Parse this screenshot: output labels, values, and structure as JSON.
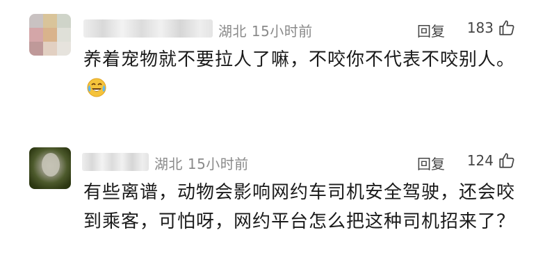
{
  "comments": [
    {
      "location": "湖北",
      "time": "15小时前",
      "reply_label": "回复",
      "like_count": "183",
      "text": "养着宠物就不要拉人了嘛，不咬你不代表不咬别人。",
      "emoji": "crying-laughing-emoji"
    },
    {
      "location": "湖北",
      "time": "15小时前",
      "reply_label": "回复",
      "like_count": "124",
      "text": "有些离谱，动物会影响网约车司机安全驾驶，还会咬到乘客，可怕呀，网约平台怎么把这种司机招来了？"
    }
  ],
  "colors": {
    "meta": "#8a8a8a",
    "text": "#1a1a1a",
    "action": "#444444"
  }
}
